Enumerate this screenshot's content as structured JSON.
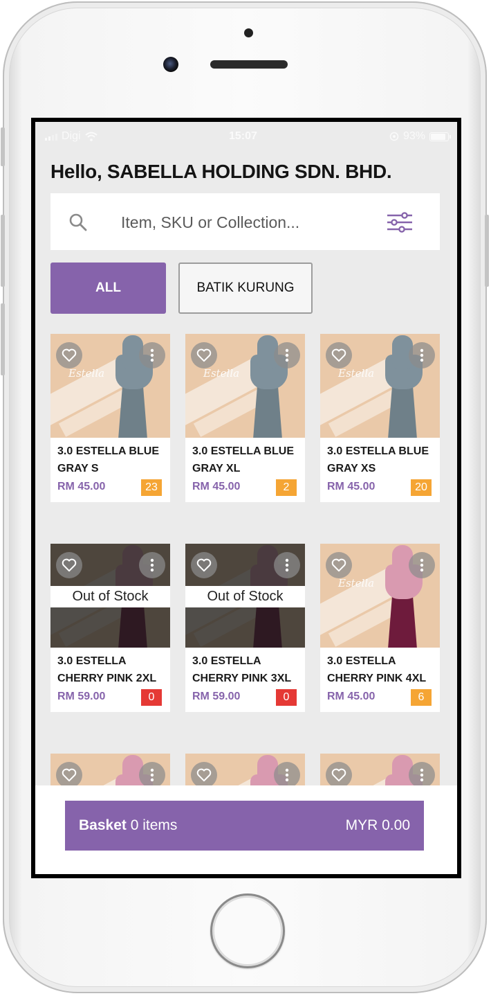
{
  "status_bar": {
    "carrier": "Digi",
    "time": "15:07",
    "battery": "93%"
  },
  "greeting": "Hello, SABELLA HOLDING SDN. BHD.",
  "search": {
    "placeholder": "Item, SKU or Collection..."
  },
  "filters": {
    "chips": [
      "ALL",
      "BATIK KURUNG"
    ],
    "selected": "ALL"
  },
  "products": [
    {
      "name": "3.0 ESTELLA BLUE GRAY S",
      "price": "RM 45.00",
      "stock": "23",
      "out_of_stock": false
    },
    {
      "name": "3.0 ESTELLA BLUE GRAY XL",
      "price": "RM 45.00",
      "stock": "2",
      "out_of_stock": false
    },
    {
      "name": "3.0 ESTELLA BLUE GRAY XS",
      "price": "RM 45.00",
      "stock": "20",
      "out_of_stock": false
    },
    {
      "name": "3.0 ESTELLA CHERRY PINK 2XL",
      "price": "RM 59.00",
      "stock": "0",
      "out_of_stock": true,
      "badge": "Out of Stock"
    },
    {
      "name": "3.0 ESTELLA CHERRY PINK 3XL",
      "price": "RM 59.00",
      "stock": "0",
      "out_of_stock": true,
      "badge": "Out of Stock"
    },
    {
      "name": "3.0 ESTELLA CHERRY PINK 4XL",
      "price": "RM 45.00",
      "stock": "6",
      "out_of_stock": false
    }
  ],
  "basket": {
    "label": "Basket",
    "count": "0 items",
    "total": "MYR 0.00"
  },
  "colors": {
    "accent": "#8663ab",
    "stock_ok": "#f5a534",
    "stock_zero": "#e53935"
  }
}
